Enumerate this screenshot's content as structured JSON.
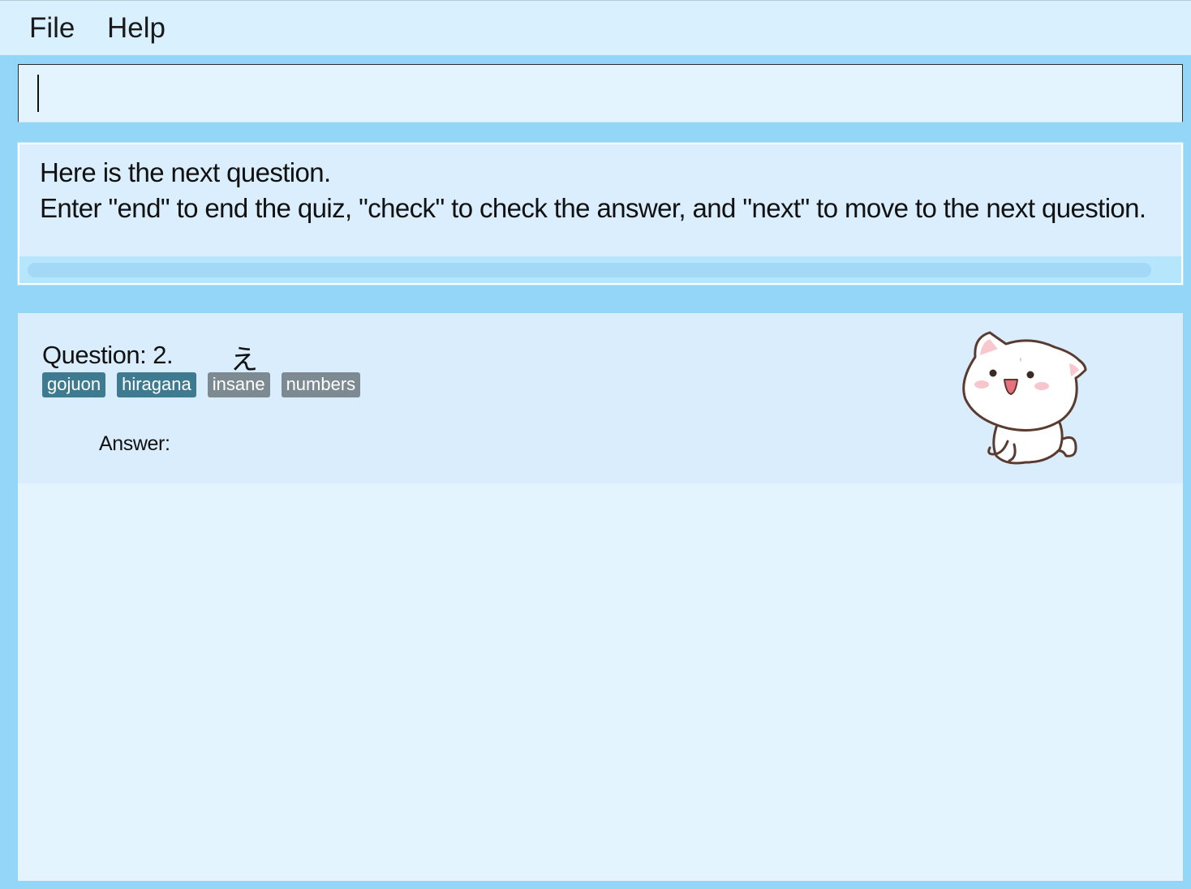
{
  "menu": {
    "file_label": "File",
    "help_label": "Help"
  },
  "command": {
    "value": "",
    "placeholder": ""
  },
  "result": {
    "line1": "Here is the next question.",
    "line2": "Enter \"end\" to end the quiz, \"check\" to check the answer, and \"next\" to move to the next question."
  },
  "card": {
    "question_label": "Question: 2.",
    "question_text": "え",
    "tags": [
      {
        "label": "gojuon",
        "color": "#3e7b91"
      },
      {
        "label": "hiragana",
        "color": "#3e7b91"
      },
      {
        "label": "insane",
        "color": "#7e8a92"
      },
      {
        "label": "numbers",
        "color": "#7e8a92"
      }
    ],
    "answer_label": "Answer:",
    "mascot_icon": "cat-mascot-icon"
  },
  "colors": {
    "background": "#93d6f8",
    "menubar": "#d9f1ff",
    "panel": "#e3f4ff",
    "card": "#d9edfd",
    "tag_primary": "#3e7b91",
    "tag_secondary": "#7e8a92"
  }
}
